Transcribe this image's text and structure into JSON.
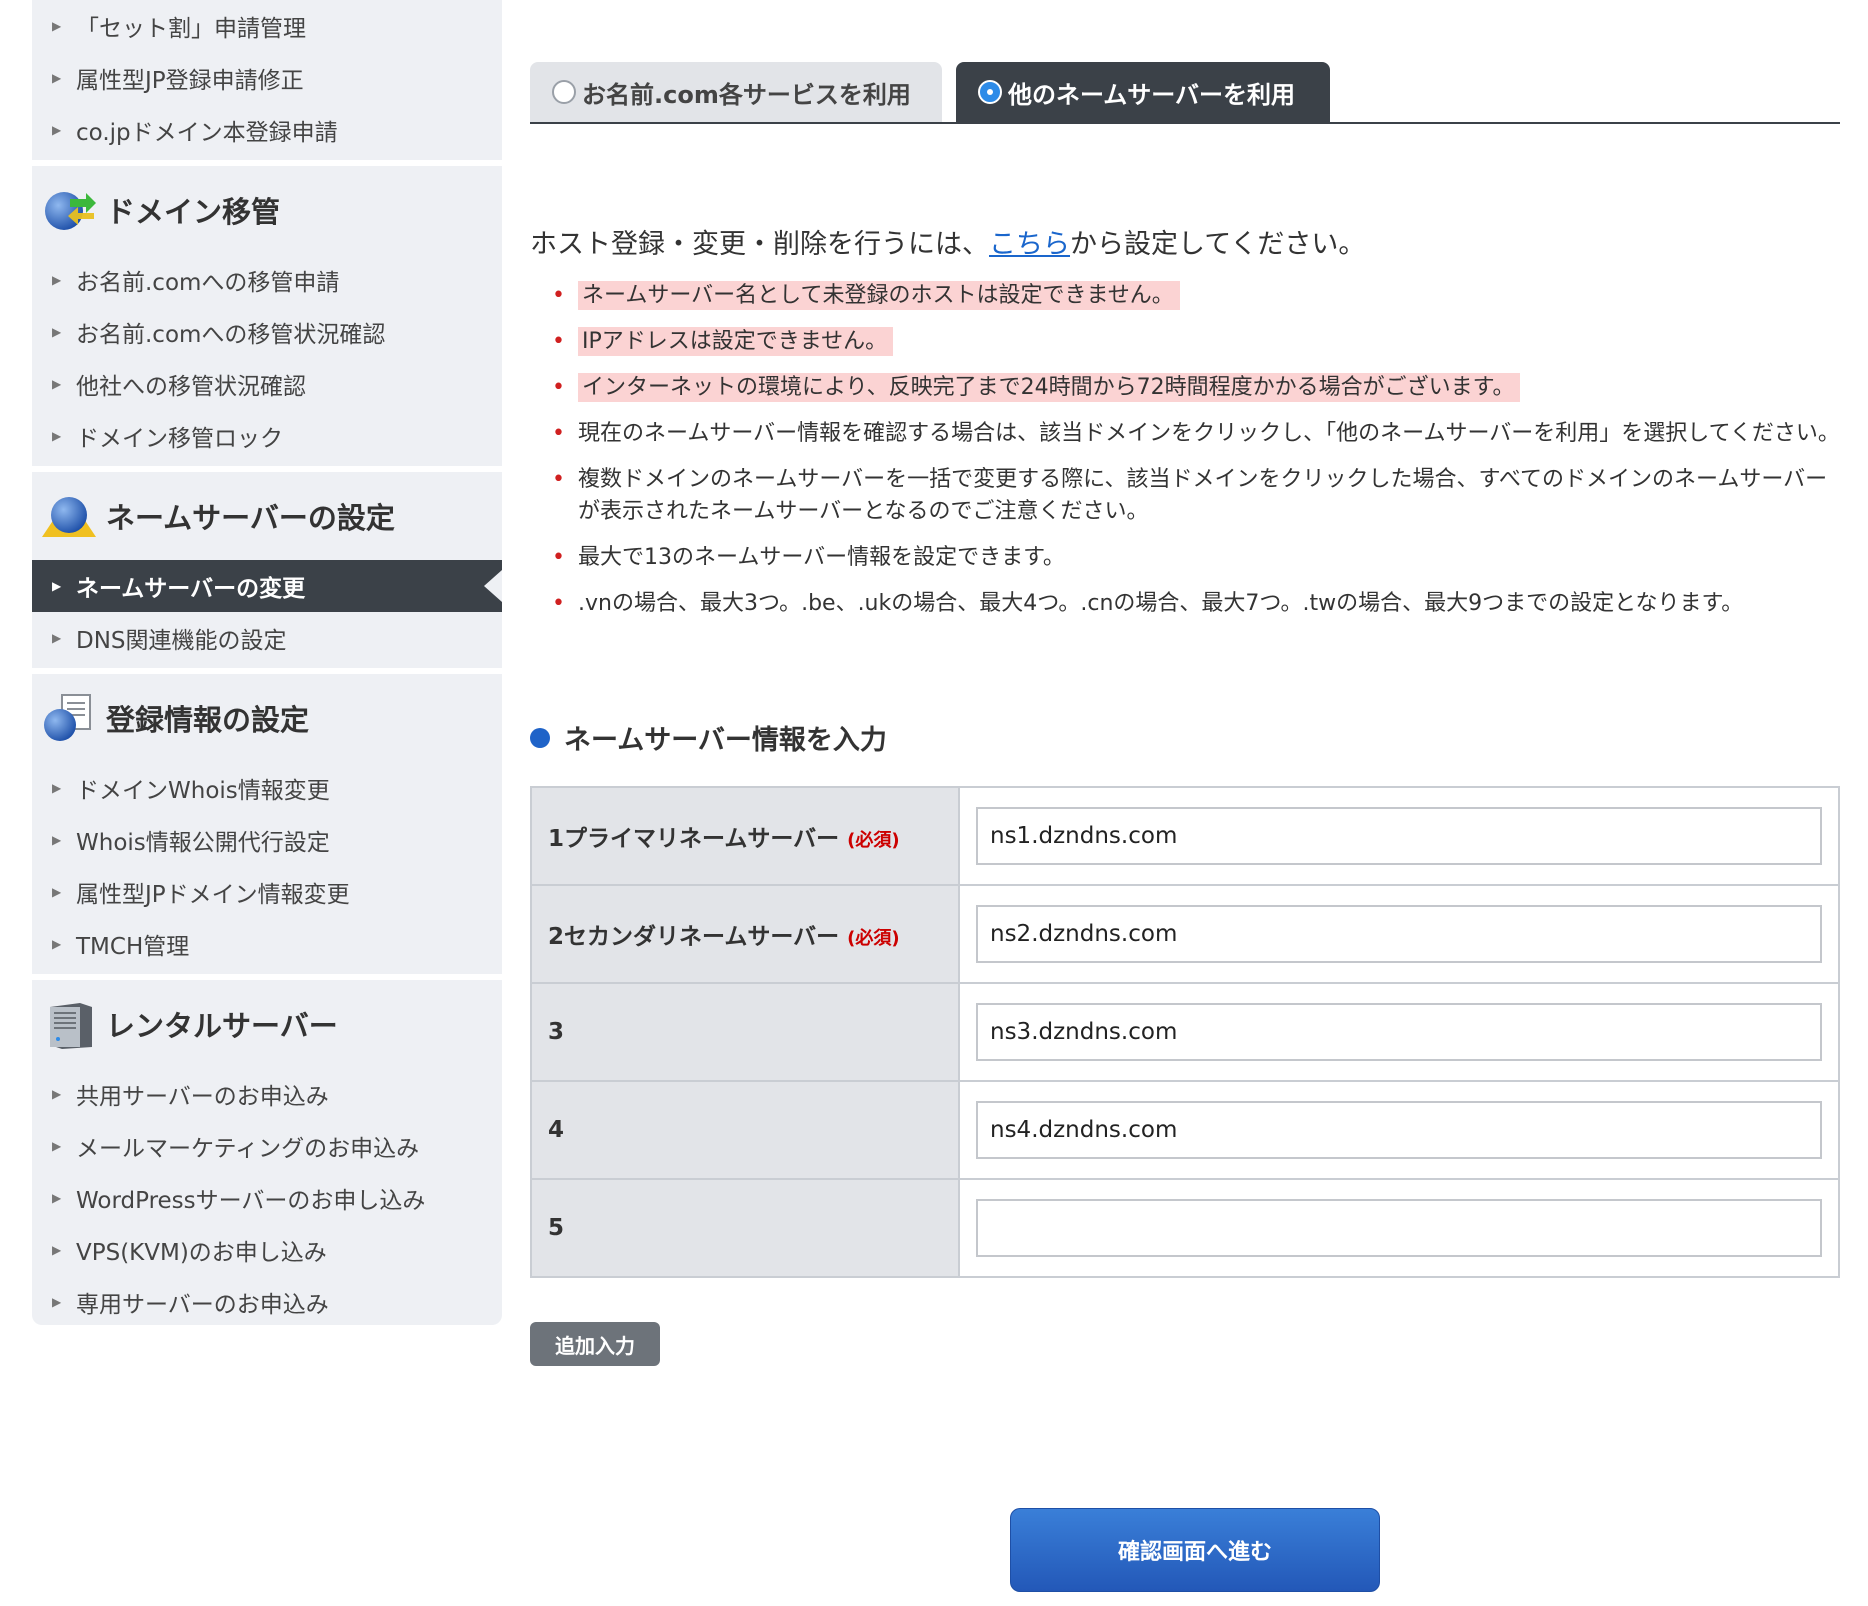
{
  "sidebar": {
    "top_items": [
      {
        "label": "「セット割」申請管理"
      },
      {
        "label": "属性型JP登録申請修正"
      },
      {
        "label": "co.jpドメイン本登録申請"
      }
    ],
    "groups": [
      {
        "title": "ドメイン移管",
        "icon": "globe-arrows-icon",
        "items": [
          {
            "label": "お名前.comへの移管申請"
          },
          {
            "label": "お名前.comへの移管状況確認"
          },
          {
            "label": "他社への移管状況確認"
          },
          {
            "label": "ドメイン移管ロック"
          }
        ]
      },
      {
        "title": "ネームサーバーの設定",
        "icon": "globe-nameserver-icon",
        "items": [
          {
            "label": "ネームサーバーの変更",
            "active": true
          },
          {
            "label": "DNS関連機能の設定"
          }
        ]
      },
      {
        "title": "登録情報の設定",
        "icon": "globe-document-icon",
        "items": [
          {
            "label": "ドメインWhois情報変更"
          },
          {
            "label": "Whois情報公開代行設定"
          },
          {
            "label": "属性型JPドメイン情報変更"
          },
          {
            "label": "TMCH管理"
          }
        ]
      },
      {
        "title": "レンタルサーバー",
        "icon": "server-icon",
        "items": [
          {
            "label": "共用サーバーのお申込み"
          },
          {
            "label": "メールマーケティングのお申込み"
          },
          {
            "label": "WordPressサーバーのお申し込み"
          },
          {
            "label": "VPS(KVM)のお申し込み"
          },
          {
            "label": "専用サーバーのお申込み"
          }
        ]
      }
    ]
  },
  "tabs": [
    {
      "label": "お名前.com各サービスを利用",
      "selected": false
    },
    {
      "label": "他のネームサーバーを利用",
      "selected": true
    }
  ],
  "intro": {
    "before": "ホスト登録・変更・削除を行うには、",
    "link": "こちら",
    "after": "から設定してください。"
  },
  "notes": [
    {
      "text": "ネームサーバー名として未登録のホストは設定できません。",
      "highlight": true
    },
    {
      "text": "IPアドレスは設定できません。",
      "highlight": true
    },
    {
      "text": "インターネットの環境により、反映完了まで24時間から72時間程度かかる場合がございます。",
      "highlight": true
    },
    {
      "text": "現在のネームサーバー情報を確認する場合は、該当ドメインをクリックし、「他のネームサーバーを利用」を選択してください。",
      "highlight": false
    },
    {
      "text": "複数ドメインのネームサーバーを一括で変更する際に、該当ドメインをクリックした場合、すべてのドメインのネームサーバーが表示されたネームサーバーとなるのでご注意ください。",
      "highlight": false
    },
    {
      "text": "最大で13のネームサーバー情報を設定できます。",
      "highlight": false
    },
    {
      "text": ".vnの場合、最大3つ。.be、.ukの場合、最大4つ。.cnの場合、最大7つ。.twの場合、最大9つまでの設定となります。",
      "highlight": false
    }
  ],
  "section_title": "ネームサーバー情報を入力",
  "nameservers": [
    {
      "label": "1プライマリネームサーバー",
      "required": "(必須)",
      "value": "ns1.dzndns.com"
    },
    {
      "label": "2セカンダリネームサーバー",
      "required": "(必須)",
      "value": "ns2.dzndns.com"
    },
    {
      "label": "3",
      "required": "",
      "value": "ns3.dzndns.com"
    },
    {
      "label": "4",
      "required": "",
      "value": "ns4.dzndns.com"
    },
    {
      "label": "5",
      "required": "",
      "value": ""
    }
  ],
  "add_button": "追加入力",
  "confirm_button": "確認画面へ進む",
  "colors": {
    "sidebar_bg": "#eef0f4",
    "active_bg": "#3b4148",
    "link": "#1a66cc",
    "highlight": "#fbd3d3",
    "bullet": "#d02020",
    "required": "#cc0000",
    "primary_button": "#2a66c4"
  }
}
